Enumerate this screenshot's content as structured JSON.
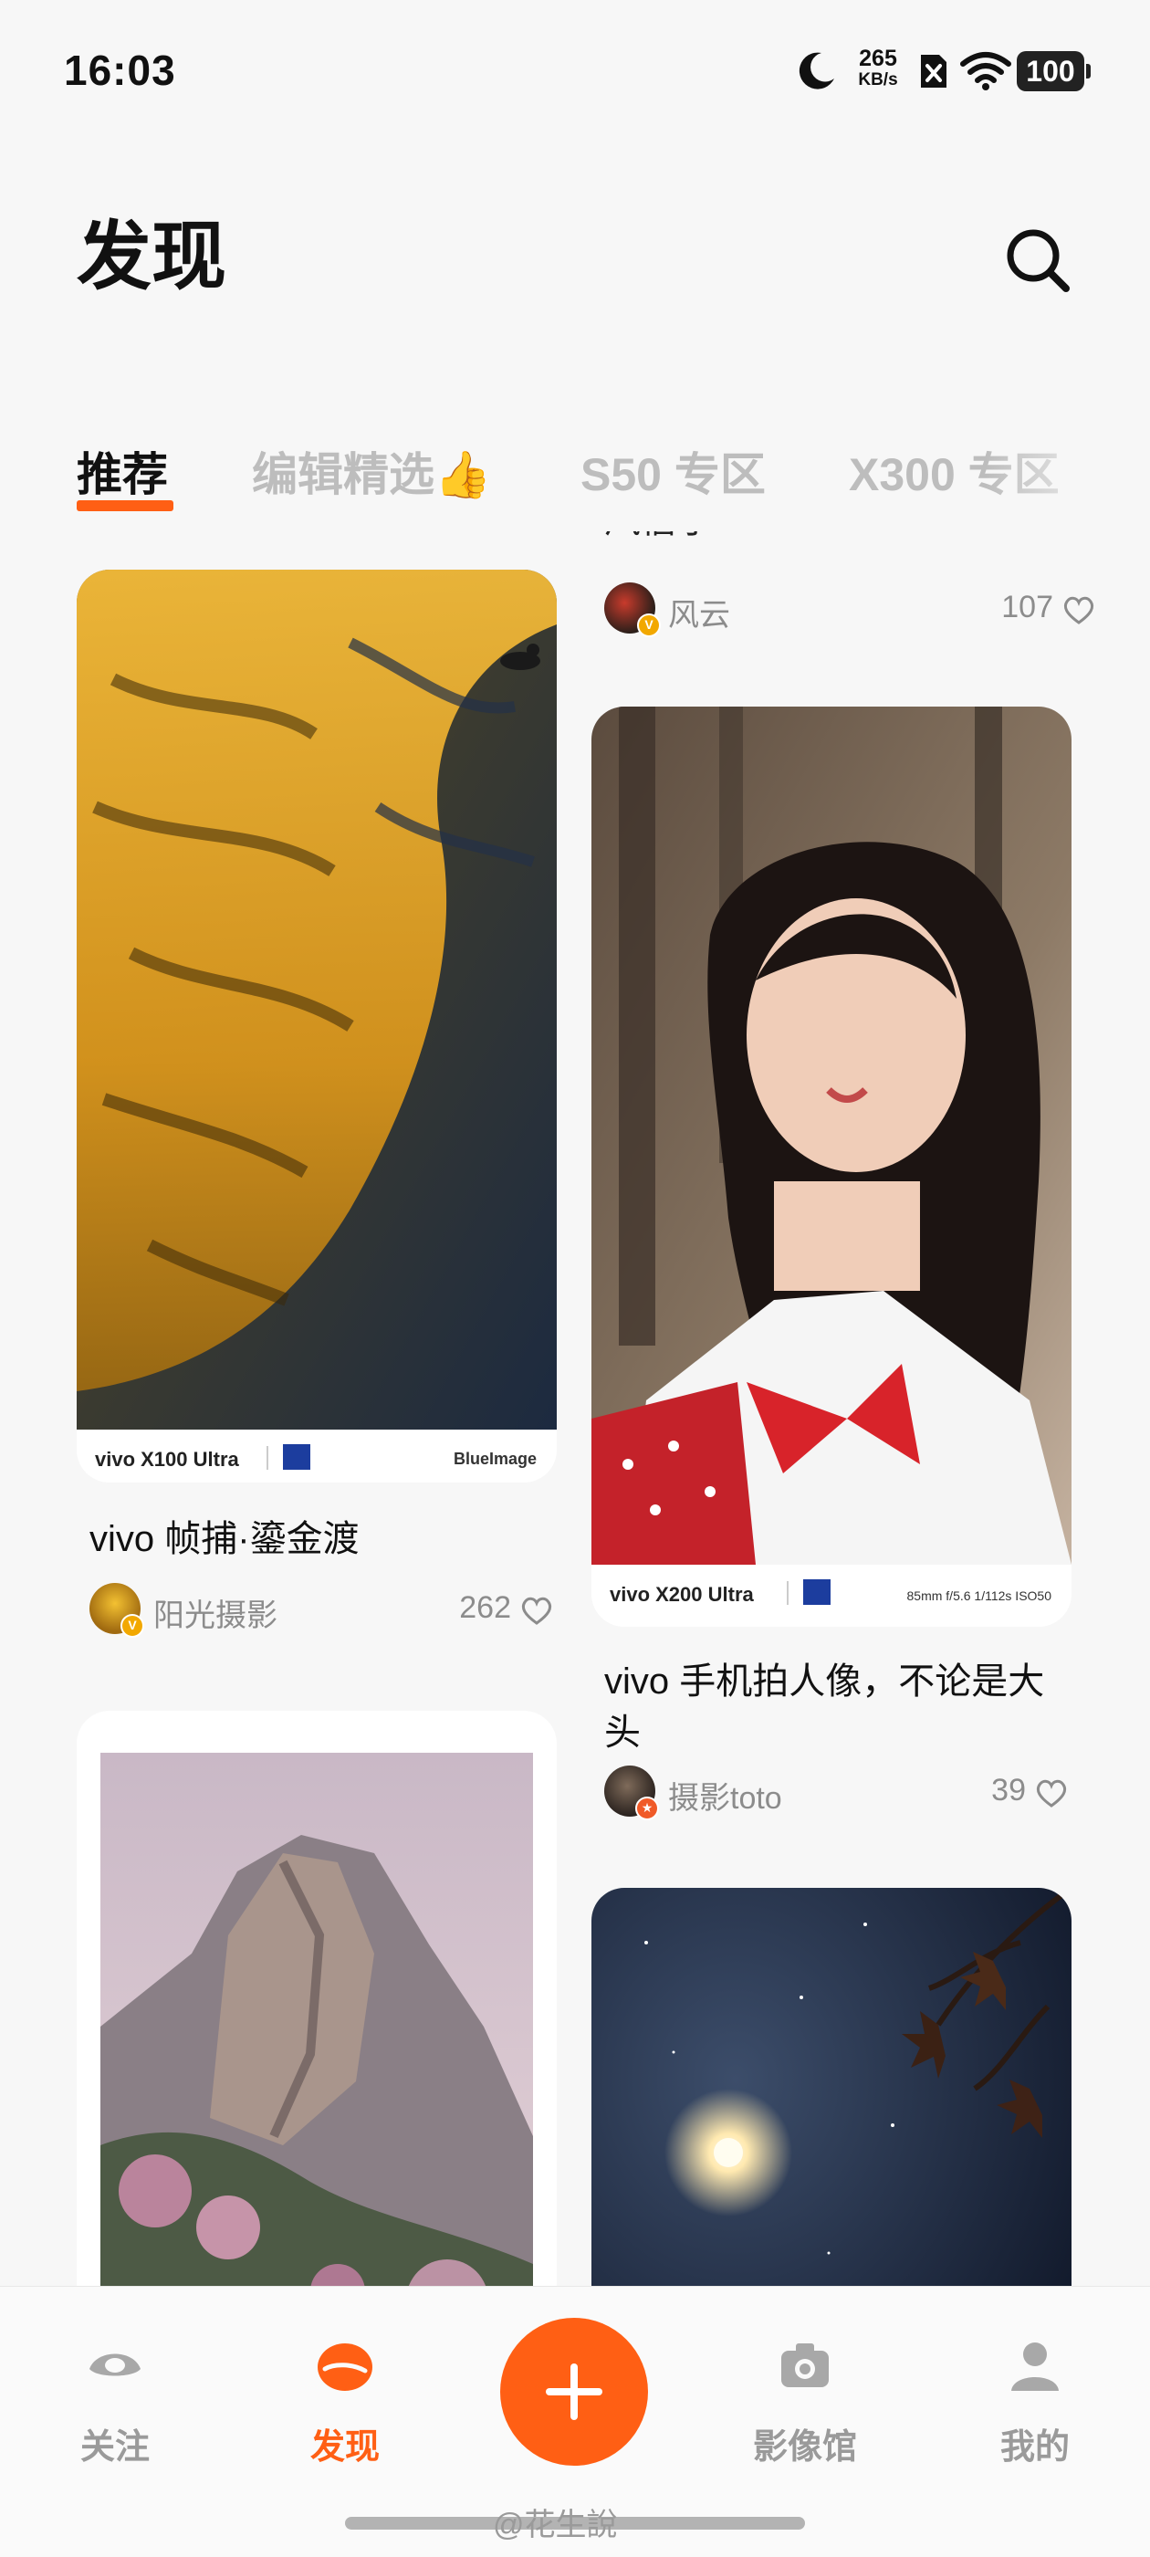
{
  "status_bar": {
    "time": "16:03",
    "net_speed_value": "265",
    "net_speed_unit": "KB/s",
    "battery": "100",
    "icons": [
      "moon-icon",
      "no-sim-icon",
      "wifi-icon",
      "battery-icon"
    ]
  },
  "header": {
    "title": "发现",
    "search_icon": "search-icon"
  },
  "tabs": [
    {
      "label": "推荐",
      "active": true
    },
    {
      "label": "编辑精选👍",
      "active": false
    },
    {
      "label": "S50 专区",
      "active": false
    },
    {
      "label": "X300 专区",
      "active": false
    }
  ],
  "feed": {
    "left": [
      {
        "title": "vivo 帧捕·鎏金渡",
        "author": "阳光摄影",
        "likes": "262",
        "watermark_brand": "vivo X100 Ultra",
        "watermark_right": "BlueImage"
      },
      {
        "title": "",
        "author": "",
        "likes": ""
      }
    ],
    "right": [
      {
        "title_partial": "风信子",
        "author": "风云",
        "likes": "107"
      },
      {
        "title": "vivo 手机拍人像，不论是大头",
        "author": "摄影toto",
        "likes": "39",
        "watermark_brand": "vivo X200 Ultra",
        "watermark_right": "85mm f/5.6 1/112s ISO50"
      },
      {
        "title": "",
        "author": "",
        "likes": ""
      }
    ]
  },
  "bottom_nav": {
    "items": [
      {
        "label": "关注",
        "icon": "eye-icon",
        "active": false
      },
      {
        "label": "发现",
        "icon": "discover-icon",
        "active": true
      },
      {
        "label": "影像馆",
        "icon": "camera-icon",
        "active": false
      },
      {
        "label": "我的",
        "icon": "profile-icon",
        "active": false
      }
    ],
    "fab_icon": "plus-icon"
  },
  "watermark": "@花生說",
  "colors": {
    "accent": "#ff5f14",
    "inactive": "#bdbdbd",
    "text": "#111111",
    "meta": "#8c8c8c"
  }
}
